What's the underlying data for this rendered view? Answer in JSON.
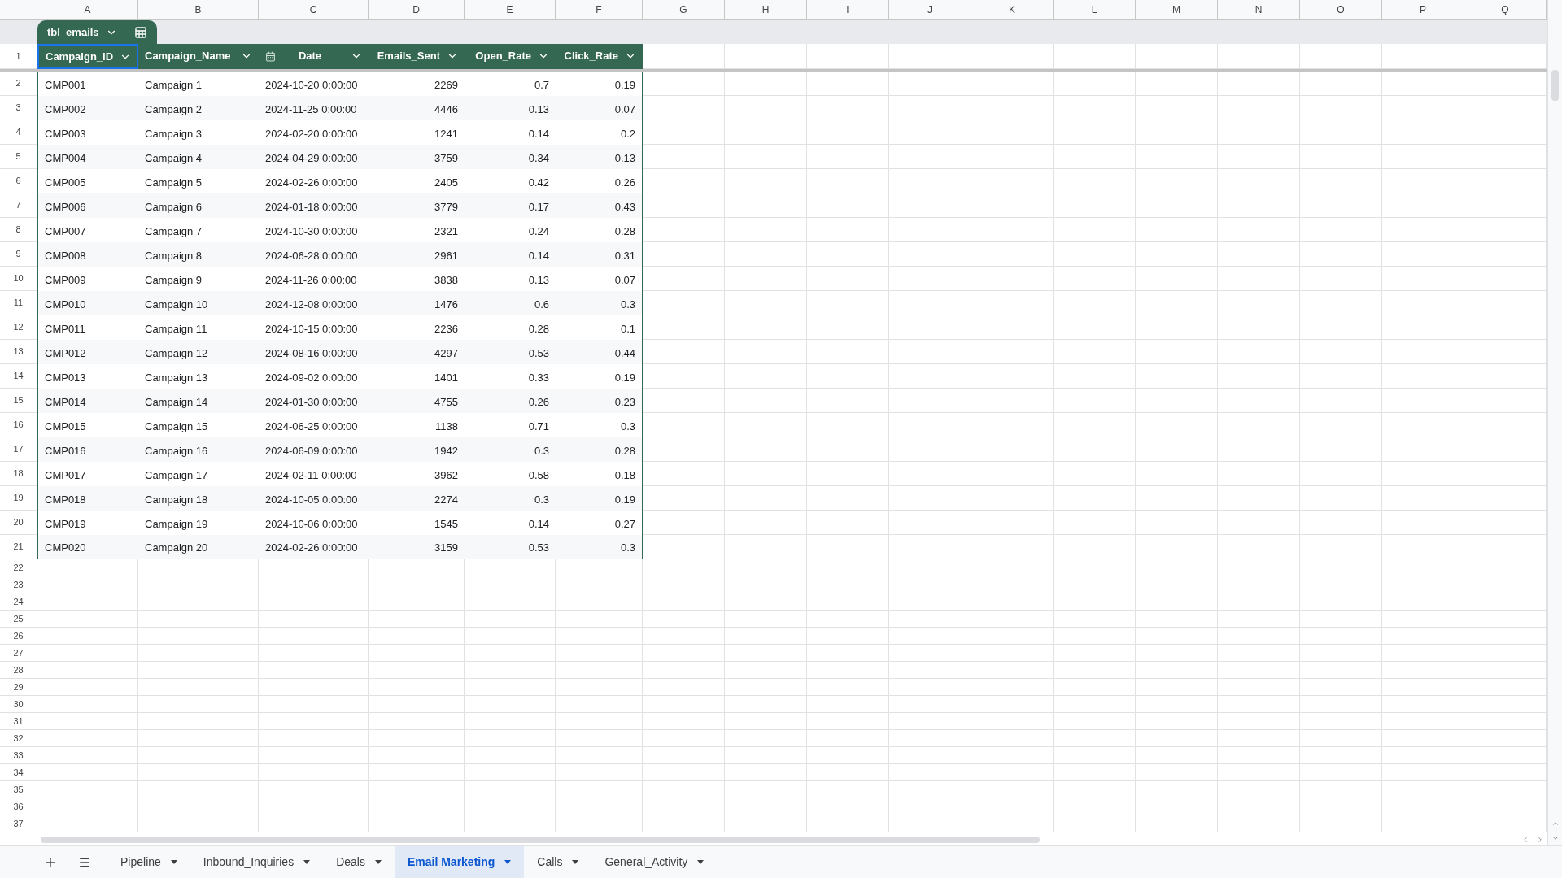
{
  "column_letters": [
    "A",
    "B",
    "C",
    "D",
    "E",
    "F",
    "G",
    "H",
    "I",
    "J",
    "K",
    "L",
    "M",
    "N",
    "O",
    "P",
    "Q"
  ],
  "table": {
    "name": "tbl_emails",
    "columns": [
      {
        "name": "Campaign_ID",
        "kind": "text",
        "selected": true
      },
      {
        "name": "Campaign_Name",
        "kind": "text",
        "selected": false
      },
      {
        "name": "Date",
        "kind": "date",
        "selected": false
      },
      {
        "name": "Emails_Sent",
        "kind": "number",
        "selected": false
      },
      {
        "name": "Open_Rate",
        "kind": "number",
        "selected": false
      },
      {
        "name": "Click_Rate",
        "kind": "number",
        "selected": false
      }
    ],
    "rows": [
      [
        "CMP001",
        "Campaign 1",
        "2024-10-20 0:00:00",
        "2269",
        "0.7",
        "0.19"
      ],
      [
        "CMP002",
        "Campaign 2",
        "2024-11-25 0:00:00",
        "4446",
        "0.13",
        "0.07"
      ],
      [
        "CMP003",
        "Campaign 3",
        "2024-02-20 0:00:00",
        "1241",
        "0.14",
        "0.2"
      ],
      [
        "CMP004",
        "Campaign 4",
        "2024-04-29 0:00:00",
        "3759",
        "0.34",
        "0.13"
      ],
      [
        "CMP005",
        "Campaign 5",
        "2024-02-26 0:00:00",
        "2405",
        "0.42",
        "0.26"
      ],
      [
        "CMP006",
        "Campaign 6",
        "2024-01-18 0:00:00",
        "3779",
        "0.17",
        "0.43"
      ],
      [
        "CMP007",
        "Campaign 7",
        "2024-10-30 0:00:00",
        "2321",
        "0.24",
        "0.28"
      ],
      [
        "CMP008",
        "Campaign 8",
        "2024-06-28 0:00:00",
        "2961",
        "0.14",
        "0.31"
      ],
      [
        "CMP009",
        "Campaign 9",
        "2024-11-26 0:00:00",
        "3838",
        "0.13",
        "0.07"
      ],
      [
        "CMP010",
        "Campaign 10",
        "2024-12-08 0:00:00",
        "1476",
        "0.6",
        "0.3"
      ],
      [
        "CMP011",
        "Campaign 11",
        "2024-10-15 0:00:00",
        "2236",
        "0.28",
        "0.1"
      ],
      [
        "CMP012",
        "Campaign 12",
        "2024-08-16 0:00:00",
        "4297",
        "0.53",
        "0.44"
      ],
      [
        "CMP013",
        "Campaign 13",
        "2024-09-02 0:00:00",
        "1401",
        "0.33",
        "0.19"
      ],
      [
        "CMP014",
        "Campaign 14",
        "2024-01-30 0:00:00",
        "4755",
        "0.26",
        "0.23"
      ],
      [
        "CMP015",
        "Campaign 15",
        "2024-06-25 0:00:00",
        "1138",
        "0.71",
        "0.3"
      ],
      [
        "CMP016",
        "Campaign 16",
        "2024-06-09 0:00:00",
        "1942",
        "0.3",
        "0.28"
      ],
      [
        "CMP017",
        "Campaign 17",
        "2024-02-11 0:00:00",
        "3962",
        "0.58",
        "0.18"
      ],
      [
        "CMP018",
        "Campaign 18",
        "2024-10-05 0:00:00",
        "2274",
        "0.3",
        "0.19"
      ],
      [
        "CMP019",
        "Campaign 19",
        "2024-10-06 0:00:00",
        "1545",
        "0.14",
        "0.27"
      ],
      [
        "CMP020",
        "Campaign 20",
        "2024-02-26 0:00:00",
        "3159",
        "0.53",
        "0.3"
      ]
    ]
  },
  "row_numbers": [
    "1",
    "2",
    "3",
    "4",
    "5",
    "6",
    "7",
    "8",
    "9",
    "10",
    "11",
    "12",
    "13",
    "14",
    "15",
    "16",
    "17",
    "18",
    "19",
    "20",
    "21",
    "22",
    "23",
    "24",
    "25",
    "26",
    "27",
    "28",
    "29",
    "30",
    "31",
    "32",
    "33",
    "34",
    "35",
    "36",
    "37"
  ],
  "sheet_tabs": [
    {
      "label": "Pipeline",
      "selected": false
    },
    {
      "label": "Inbound_Inquiries",
      "selected": false
    },
    {
      "label": "Deals",
      "selected": false
    },
    {
      "label": "Email Marketing",
      "selected": true
    },
    {
      "label": "Calls",
      "selected": false
    },
    {
      "label": "General_Activity",
      "selected": false
    }
  ]
}
